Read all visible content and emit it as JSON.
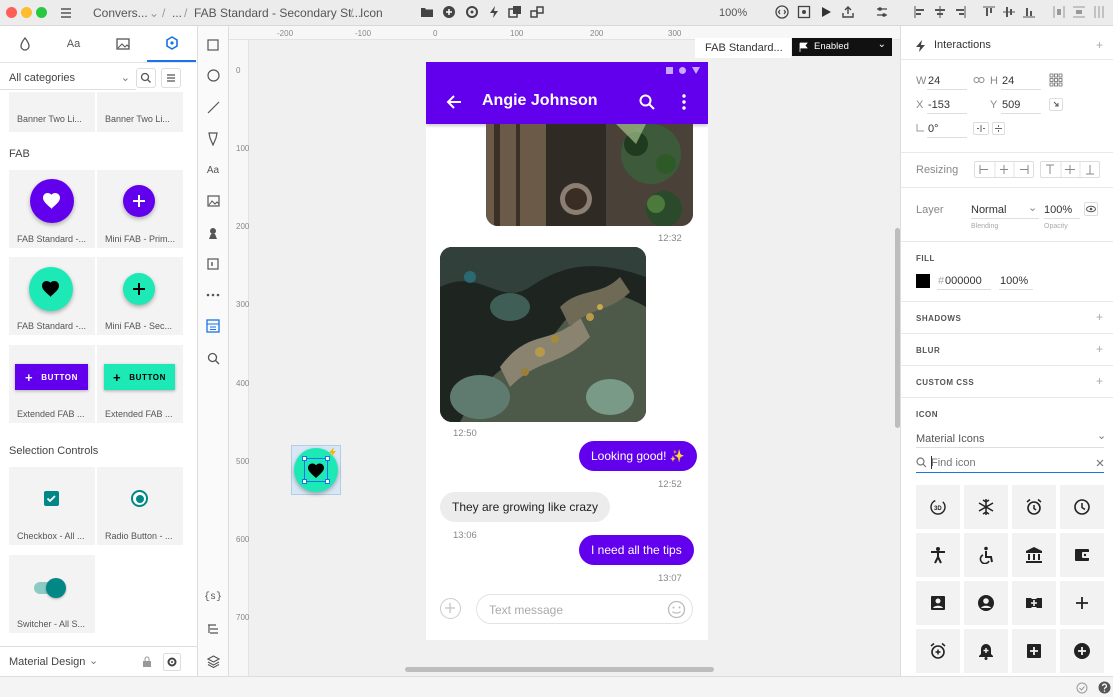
{
  "titlebar": {
    "crumbs": [
      "Convers...",
      "...",
      "FAB Standard - Secondary St...",
      "Icon"
    ],
    "zoom": "100%"
  },
  "left": {
    "category": "All categories",
    "row0": [
      "Banner Two Li...",
      "Banner Two Li..."
    ],
    "fab_title": "FAB",
    "fab_cards": [
      "FAB Standard -...",
      "Mini FAB - Prim...",
      "FAB Standard -...",
      "Mini FAB - Sec...",
      "Extended FAB ...",
      "Extended FAB ..."
    ],
    "button_label": "BUTTON",
    "sel_title": "Selection Controls",
    "sel_cards": [
      "Checkbox - All ...",
      "Radio Button - ...",
      "Switcher - All S..."
    ],
    "library": "Material Design",
    "tab_text": "Aa"
  },
  "tools": {
    "text_tool": "Aa",
    "css_tool": "{s}"
  },
  "canvas": {
    "ruler_h": [
      "-200",
      "-100",
      "0",
      "100",
      "200",
      "300"
    ],
    "ruler_v": [
      "0",
      "100",
      "200",
      "300",
      "400",
      "500",
      "600",
      "700"
    ],
    "state_name": "FAB Standard...",
    "state_value": "Enabled"
  },
  "phone": {
    "title": "Angie Johnson",
    "t1": "12:32",
    "t2": "12:50",
    "msg1": "Looking good! ✨",
    "t3": "12:52",
    "msg2": "They are growing like crazy",
    "t4": "13:06",
    "msg3": "I need all the tips",
    "t5": "13:07",
    "placeholder": "Text message"
  },
  "right": {
    "interactions": "Interactions",
    "w_label": "W",
    "w": "24",
    "h_label": "H",
    "h": "24",
    "x_label": "X",
    "x": "-153",
    "y_label": "Y",
    "y": "509",
    "rot": "0°",
    "resizing": "Resizing",
    "layer": "Layer",
    "blend": "Normal",
    "blend_caption": "Blending",
    "opacity": "100%",
    "opacity_caption": "Opacity",
    "fill": "FILL",
    "fill_hex": "000000",
    "fill_opacity": "100%",
    "shadows": "SHADOWS",
    "blur": "BLUR",
    "custom_css": "CUSTOM CSS",
    "icon": "ICON",
    "icon_set": "Material Icons",
    "find_placeholder": "Find icon"
  },
  "icons": [
    "3d-rotation-icon",
    "ac-unit-icon",
    "access-alarm-icon",
    "access-time-icon",
    "accessibility-icon",
    "accessible-icon",
    "account-balance-icon",
    "account-balance-wallet-icon",
    "account-box-icon",
    "account-circle-icon",
    "add-to-queue-icon",
    "add-icon",
    "add-alarm-icon",
    "add-alert-icon",
    "add-box-icon",
    "add-circle-icon"
  ],
  "colors": {
    "primary": "#6200ee",
    "secondary": "#1de9b6",
    "accent_blue": "#1a73e8"
  }
}
